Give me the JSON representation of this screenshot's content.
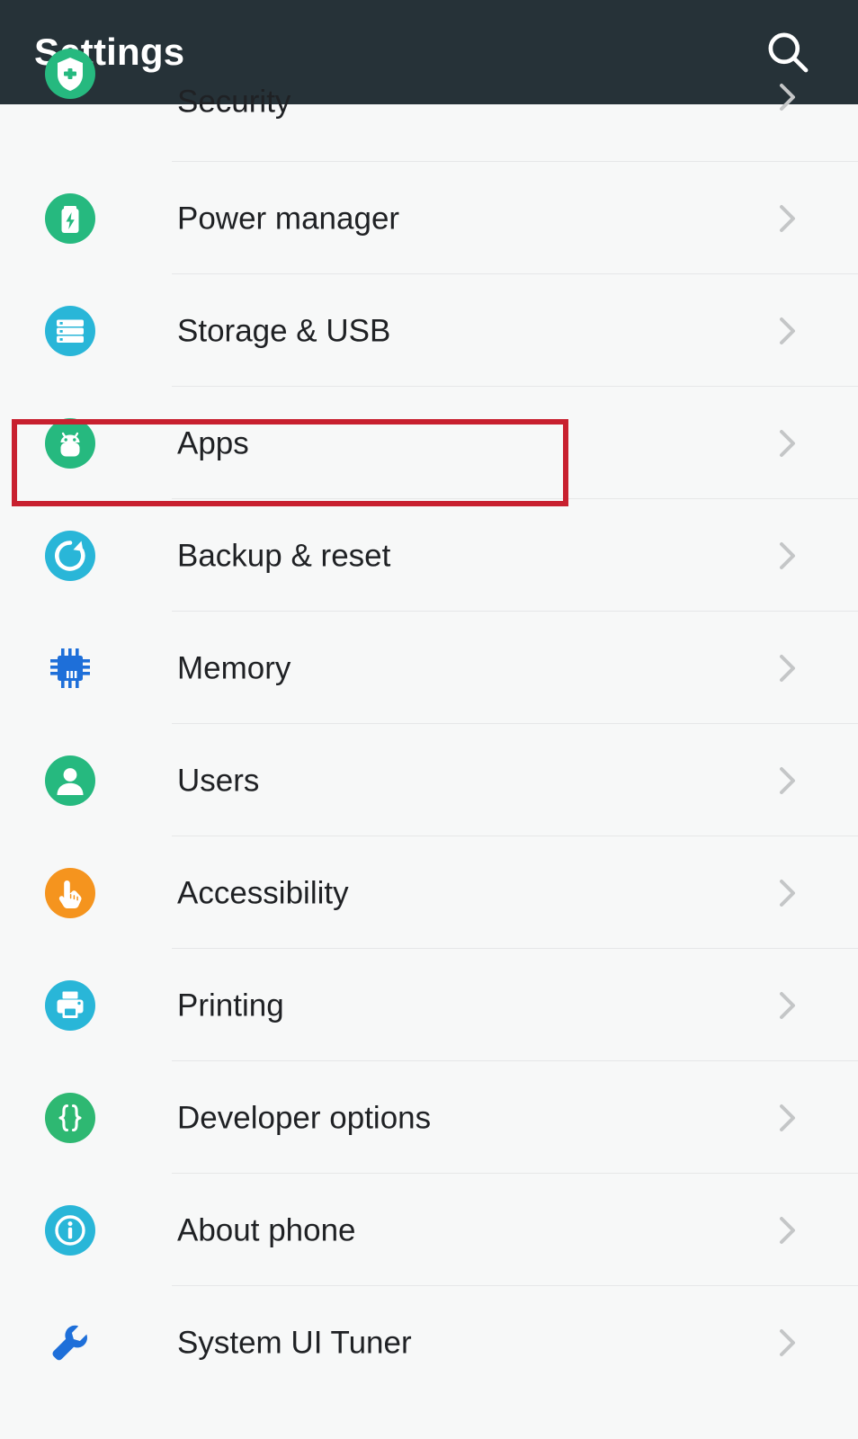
{
  "appbar": {
    "title": "Settings",
    "search_icon": "search-icon",
    "background_color": "#263238",
    "title_color": "#ffffff"
  },
  "list": {
    "divider_color": "#e6e7e8",
    "background_color": "#f7f8f8",
    "label_color": "#1f2124",
    "chevron_color": "#c4c6c7",
    "chevron_icon": "chevron-right-icon",
    "items": [
      {
        "label": "Security",
        "icon": "shield-icon",
        "icon_color": "#26b97f",
        "icon_shape": "circle",
        "clipped": true
      },
      {
        "label": "Power manager",
        "icon": "battery-charging-icon",
        "icon_color": "#26b97f",
        "icon_shape": "circle",
        "clipped": false
      },
      {
        "label": "Storage & USB",
        "icon": "storage-icon",
        "icon_color": "#29b6d8",
        "icon_shape": "circle",
        "clipped": false
      },
      {
        "label": "Apps",
        "icon": "android-robot-icon",
        "icon_color": "#26b97f",
        "icon_shape": "circle",
        "clipped": false
      },
      {
        "label": "Backup & reset",
        "icon": "restore-icon",
        "icon_color": "#29b6d8",
        "icon_shape": "circle",
        "clipped": false
      },
      {
        "label": "Memory",
        "icon": "memory-chip-icon",
        "icon_color": "#1e6fd9",
        "icon_shape": "glyph",
        "clipped": false
      },
      {
        "label": "Users",
        "icon": "person-icon",
        "icon_color": "#26b97f",
        "icon_shape": "circle",
        "clipped": false
      },
      {
        "label": "Accessibility",
        "icon": "hand-pointer-icon",
        "icon_color": "#f5941e",
        "icon_shape": "circle",
        "clipped": false
      },
      {
        "label": "Printing",
        "icon": "printer-icon",
        "icon_color": "#29b6d8",
        "icon_shape": "circle",
        "clipped": false
      },
      {
        "label": "Developer options",
        "icon": "curly-braces-icon",
        "icon_color": "#2eb872",
        "icon_shape": "circle",
        "clipped": false
      },
      {
        "label": "About phone",
        "icon": "info-icon",
        "icon_color": "#29b6d8",
        "icon_shape": "circle",
        "clipped": false
      },
      {
        "label": "System UI Tuner",
        "icon": "wrench-icon",
        "icon_color": "#1e6fd9",
        "icon_shape": "glyph",
        "clipped": false
      }
    ]
  },
  "annotation": {
    "target_label": "Apps",
    "color": "#c8202f"
  }
}
